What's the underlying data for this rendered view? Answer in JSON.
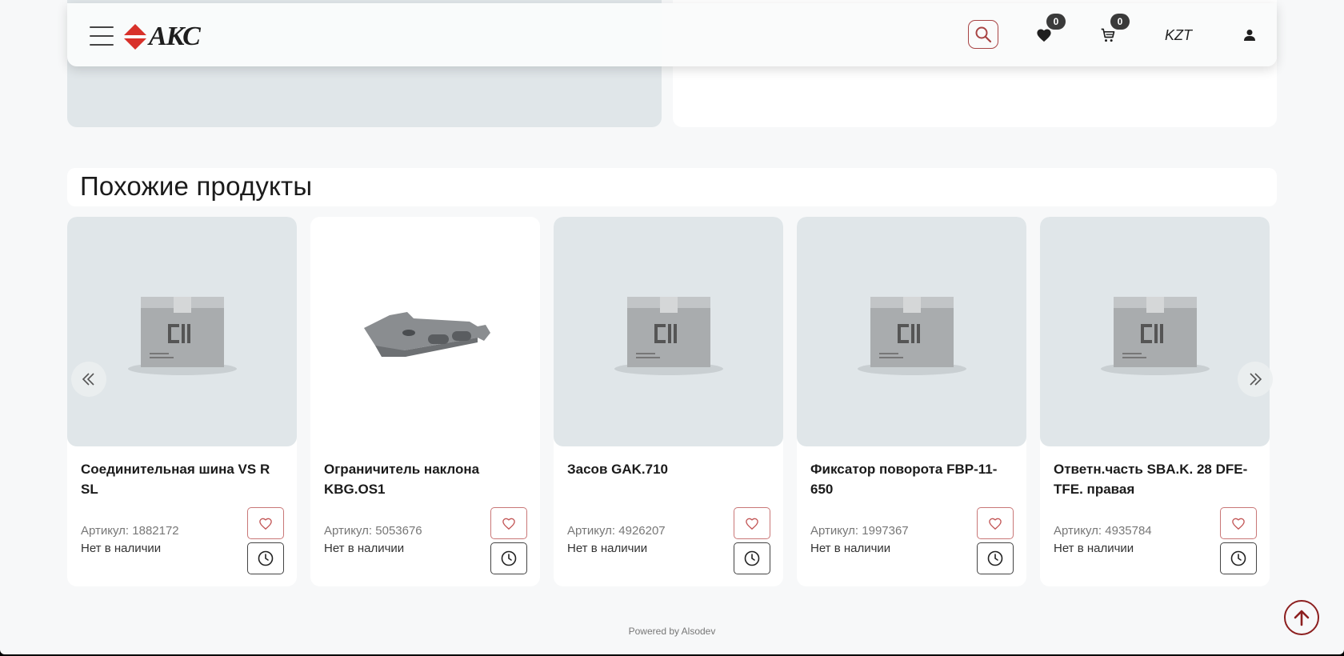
{
  "header": {
    "logo_text": "АКС",
    "currency": "KZT",
    "favorites_count": "0",
    "cart_count": "0"
  },
  "section": {
    "title": "Похожие продукты"
  },
  "products": [
    {
      "name": "Соединительная шина VS R SL",
      "sku": "Артикул: 1882172",
      "stock": "Нет в наличии",
      "image": "box-placeholder"
    },
    {
      "name": "Ограничитель наклона KBG.OS1",
      "sku": "Артикул: 5053676",
      "stock": "Нет в наличии",
      "image": "metal-part"
    },
    {
      "name": "Засов GAK.710",
      "sku": "Артикул: 4926207",
      "stock": "Нет в наличии",
      "image": "box-placeholder"
    },
    {
      "name": "Фиксатор поворота FBP-11-650",
      "sku": "Артикул: 1997367",
      "stock": "Нет в наличии",
      "image": "box-placeholder"
    },
    {
      "name": "Ответн.часть SBA.K. 28 DFE-TFE. правая",
      "sku": "Артикул: 4935784",
      "stock": "Нет в наличии",
      "image": "box-placeholder"
    }
  ],
  "footer": {
    "powered_by": "Powered by Alsodev"
  },
  "colors": {
    "brand_red": "#a84444",
    "badge_dark": "#3a3a3a",
    "card_image_bg": "#e0e6e9"
  }
}
